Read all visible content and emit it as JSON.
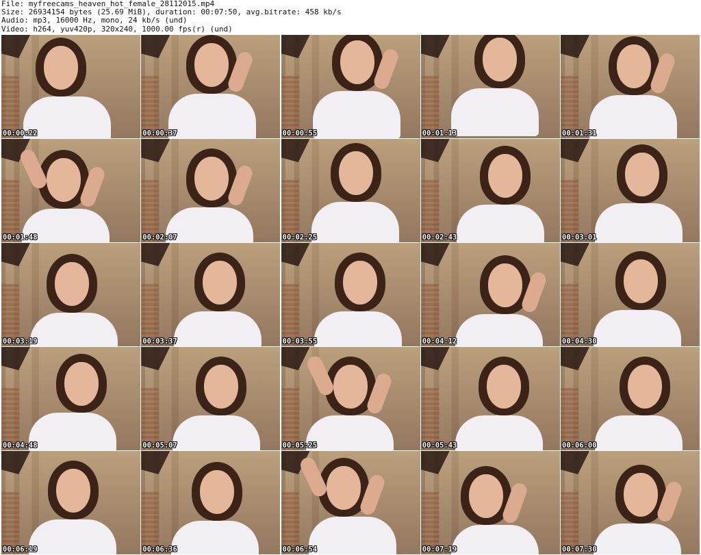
{
  "header": {
    "file_line": "File: myfreecams_heaven_hot_female_28112015.mp4",
    "size_line": "Size: 26934154 bytes (25.69 MiB), duration: 00:07:50, avg.bitrate: 458 kb/s",
    "audio_line": "Audio: mp3, 16000 Hz, mono, 24 kb/s (und)",
    "video_line": "Video: h264, yuv420p, 320x240, 1000.00 fps(r) (und)"
  },
  "thumbnails": [
    {
      "timestamp": "00:00:22"
    },
    {
      "timestamp": "00:00:37"
    },
    {
      "timestamp": "00:00:55"
    },
    {
      "timestamp": "00:01:13"
    },
    {
      "timestamp": "00:01:31"
    },
    {
      "timestamp": "00:01:48"
    },
    {
      "timestamp": "00:02:07"
    },
    {
      "timestamp": "00:02:25"
    },
    {
      "timestamp": "00:02:43"
    },
    {
      "timestamp": "00:03:01"
    },
    {
      "timestamp": "00:03:19"
    },
    {
      "timestamp": "00:03:37"
    },
    {
      "timestamp": "00:03:55"
    },
    {
      "timestamp": "00:04:12"
    },
    {
      "timestamp": "00:04:30"
    },
    {
      "timestamp": "00:04:48"
    },
    {
      "timestamp": "00:05:07"
    },
    {
      "timestamp": "00:05:25"
    },
    {
      "timestamp": "00:05:43"
    },
    {
      "timestamp": "00:06:00"
    },
    {
      "timestamp": "00:06:19"
    },
    {
      "timestamp": "00:06:36"
    },
    {
      "timestamp": "00:06:54"
    },
    {
      "timestamp": "00:07:19"
    },
    {
      "timestamp": "00:07:30"
    }
  ]
}
